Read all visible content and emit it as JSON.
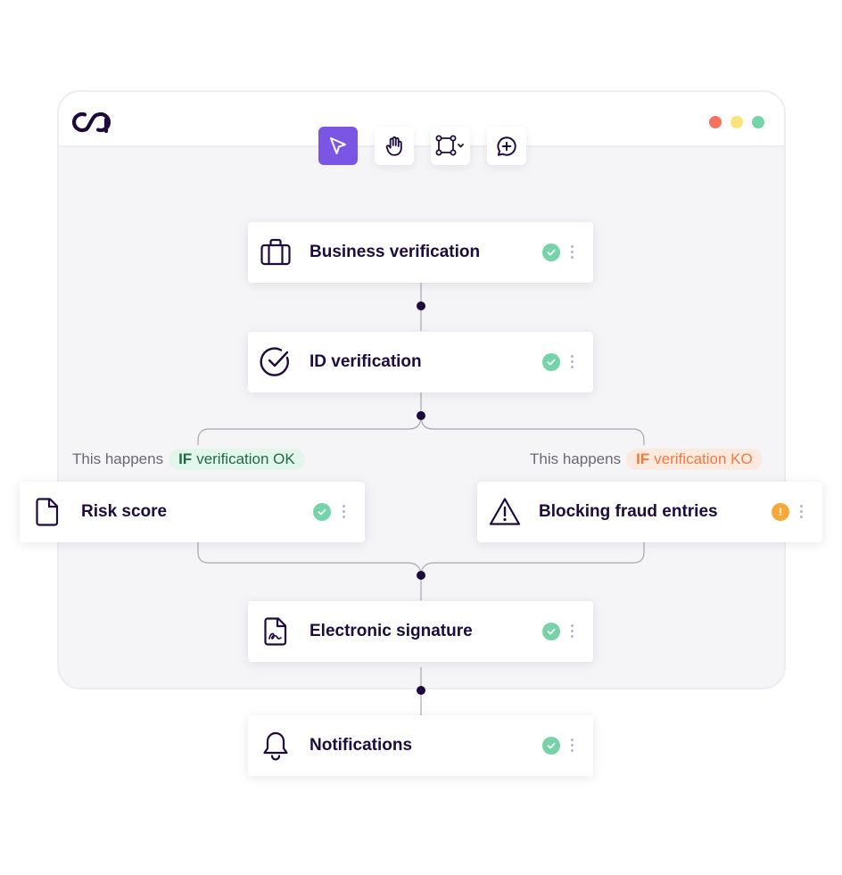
{
  "app": {
    "logo_name": "ca-logo"
  },
  "window_controls": {
    "colors": [
      "#f4735f",
      "#f7e47a",
      "#74d4a8"
    ]
  },
  "toolbar": {
    "tools": [
      {
        "name": "pointer",
        "active": true
      },
      {
        "name": "hand",
        "active": false
      },
      {
        "name": "node-connect",
        "active": false
      },
      {
        "name": "comment-add",
        "active": false
      }
    ]
  },
  "steps": {
    "business": {
      "title": "Business verification",
      "status": "ok",
      "icon": "briefcase-icon"
    },
    "id": {
      "title": "ID verification",
      "status": "ok",
      "icon": "check-circle-icon"
    },
    "risk": {
      "title": "Risk score",
      "status": "ok",
      "icon": "document-icon"
    },
    "fraud": {
      "title": "Blocking fraud entries",
      "status": "warning",
      "status_glyph": "!",
      "icon": "warning-triangle-icon"
    },
    "signature": {
      "title": "Electronic signature",
      "status": "ok",
      "icon": "signature-document-icon"
    },
    "notifications": {
      "title": "Notifications",
      "status": "ok",
      "icon": "bell-icon"
    }
  },
  "conditions": {
    "ok": {
      "lead": "This happens",
      "keyword": "IF",
      "text": "verification OK"
    },
    "ko": {
      "lead": "This happens",
      "keyword": "IF",
      "text": "verification KO"
    }
  },
  "colors": {
    "accent": "#7b55e3",
    "ink": "#1e0a3c",
    "ok": "#74d4a8",
    "warning": "#f6a83a",
    "ko_text": "#f07a42"
  }
}
